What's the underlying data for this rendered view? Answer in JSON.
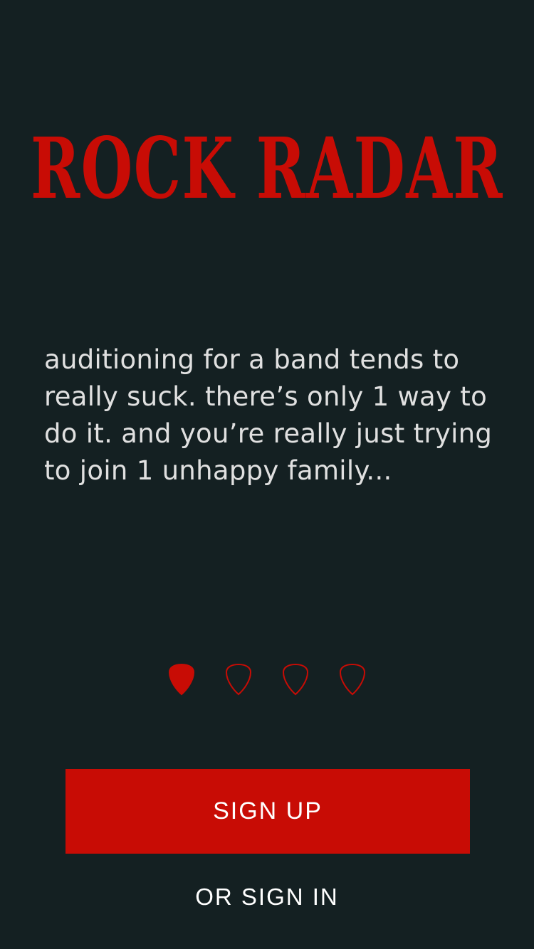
{
  "app": {
    "logo_text": "ROCK RADAR"
  },
  "onboarding": {
    "message": "auditioning for a band tends to really suck. there’s only 1 way to do it. and you’re really just trying to join 1 unhappy family...",
    "pages_total": 4,
    "current_page": 1
  },
  "actions": {
    "signup_label": "SIGN UP",
    "signin_label": "OR SIGN IN"
  },
  "colors": {
    "background": "#142022",
    "accent": "#c80c05",
    "text": "#e0e0e0"
  }
}
